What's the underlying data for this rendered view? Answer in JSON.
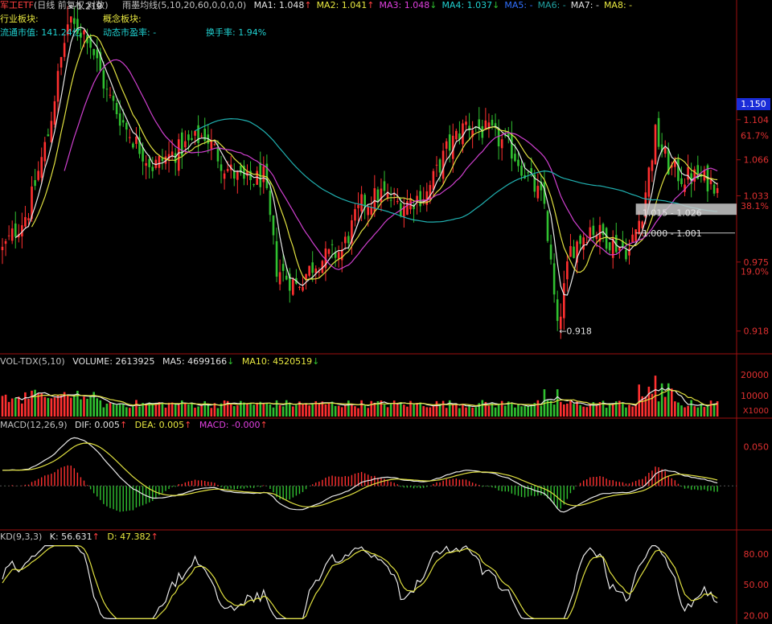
{
  "header": {
    "title": "军工ETF",
    "mode": "(日线 前复权 对数)",
    "ma_system": "雨墨均线(5,10,20,60,0,0,0,0)",
    "ma_readouts": [
      {
        "label": "MA1: 1.048",
        "arrow": "↑",
        "color": "#e0e0e0"
      },
      {
        "label": "MA2: 1.041",
        "arrow": "↑",
        "color": "#e8e840"
      },
      {
        "label": "MA3: 1.048",
        "arrow": "↓",
        "color": "#e040e0"
      },
      {
        "label": "MA4: 1.037",
        "arrow": "↓",
        "color": "#20d0d0"
      },
      {
        "label": "MA5: -",
        "arrow": "",
        "color": "#3070ff"
      },
      {
        "label": "MA6: -",
        "arrow": "",
        "color": "#20a0a0"
      },
      {
        "label": "MA7: -",
        "arrow": "",
        "color": "#e0e0e0"
      },
      {
        "label": "MA8: -",
        "arrow": "",
        "color": "#e8e840"
      }
    ],
    "industry_label": "行业板块:",
    "concept_label": "概念板块:",
    "float_cap": "流通市值: 141.24亿",
    "dyn_pe": "动态市盈率: -",
    "turnover": "换手率: 1.94%",
    "current_price": "1.150"
  },
  "colors": {
    "up": "#ff3030",
    "down": "#30c030",
    "ma5": "#e8e8e8",
    "ma10": "#e0e040",
    "ma20": "#d040d0",
    "ma60": "#20b0b0",
    "axis": "#a01010"
  },
  "chart_data": [
    {
      "type": "candlestick",
      "name": "price",
      "scale": "log",
      "ylim": [
        0.905,
        1.175
      ],
      "y_ticks": [
        "1.104",
        "1.066",
        "1.033",
        "0.975",
        "0.918"
      ],
      "fib_labels": [
        {
          "text": "61.7%",
          "value": 1.089
        },
        {
          "text": "38.1%",
          "value": 1.024
        },
        {
          "text": "19.0%",
          "value": 0.967
        }
      ],
      "annotations": [
        {
          "text": "1.219",
          "value": 1.219,
          "index": 20
        },
        {
          "text": "0.918",
          "value": 0.918,
          "index": 170
        },
        {
          "text": "1.015 - 1.026",
          "value": 1.018,
          "index": 196
        },
        {
          "text": "1.000 - 1.001",
          "value": 1.0,
          "index": 196
        }
      ],
      "box": {
        "low": 1.016,
        "high": 1.026,
        "from_index": 194
      }
    },
    {
      "type": "bar",
      "name": "volume",
      "title": "VOL-TDX(5,10)",
      "readouts": [
        "VOLUME: 2613925",
        "MA5: 4699166",
        "MA10: 4520519"
      ],
      "readout_arrows": [
        "↓",
        "↓"
      ],
      "y_ticks": [
        "20000",
        "10000"
      ],
      "unit": "X1000",
      "ylim": [
        0,
        23000
      ]
    },
    {
      "type": "macd",
      "name": "macd",
      "title": "MACD(12,26,9)",
      "readouts": [
        "DIF: 0.005",
        "DEA: 0.005",
        "MACD: -0.000"
      ],
      "readout_arrows": [
        "↑",
        "↑",
        "↑"
      ],
      "y_ticks": [
        "0.050"
      ],
      "ylim": [
        -0.052,
        0.07
      ]
    },
    {
      "type": "line",
      "name": "kd",
      "title": "KD(9,3,3)",
      "readouts": [
        "K: 56.631",
        "D: 47.382"
      ],
      "readout_arrows": [
        "↑",
        "↑"
      ],
      "y_ticks": [
        "80.00",
        "50.00",
        "20.00"
      ],
      "ylim": [
        15,
        90
      ]
    }
  ]
}
